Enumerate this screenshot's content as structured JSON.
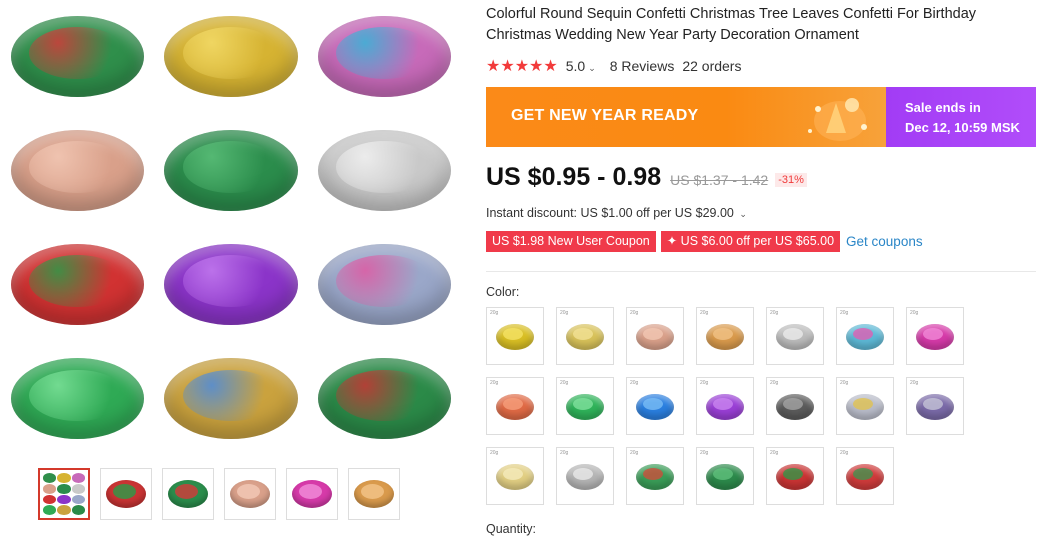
{
  "gallery": {
    "main_tiles": [
      {
        "name": "green-red-tree-leaves",
        "c1": "#2f8f4b",
        "c2": "#d43a3a"
      },
      {
        "name": "gold-round",
        "c1": "#d6b332",
        "c2": "#f4dc6a"
      },
      {
        "name": "multicolor-round",
        "c1": "#c76ab9",
        "c2": "#36b6d8"
      },
      {
        "name": "rose-gold-round",
        "c1": "#d9a08a",
        "c2": "#f3c9b6"
      },
      {
        "name": "green-tree-leaves",
        "c1": "#2b8d4c",
        "c2": "#5cc07a"
      },
      {
        "name": "silver-round",
        "c1": "#c9c9c9",
        "c2": "#f2f2f2"
      },
      {
        "name": "red-green-tree-leaves",
        "c1": "#d13232",
        "c2": "#2a9c48"
      },
      {
        "name": "purple-round",
        "c1": "#8b34c9",
        "c2": "#c47cf0"
      },
      {
        "name": "holographic-mix",
        "c1": "#9aa7c9",
        "c2": "#e05aa3"
      },
      {
        "name": "green-round",
        "c1": "#2faa55",
        "c2": "#7ee39b"
      },
      {
        "name": "multicolor-stars",
        "c1": "#caa23e",
        "c2": "#4b8be0"
      },
      {
        "name": "green-red-leaves-mix",
        "c1": "#2b8a48",
        "c2": "#c93434"
      }
    ],
    "thumbnails": [
      {
        "name": "thumb-all-colors",
        "c1": "#8b34c9",
        "c2": "#d6b332",
        "active": true
      },
      {
        "name": "thumb-red-green",
        "c1": "#c93434",
        "c2": "#2a9c48",
        "active": false
      },
      {
        "name": "thumb-green",
        "c1": "#2b8d4c",
        "c2": "#d43a3a",
        "active": false
      },
      {
        "name": "thumb-rose-gold",
        "c1": "#d9a08a",
        "c2": "#f3c9b6",
        "active": false
      },
      {
        "name": "thumb-pink",
        "c1": "#d63aa9",
        "c2": "#f18ed9",
        "active": false
      },
      {
        "name": "thumb-copper",
        "c1": "#d99a4c",
        "c2": "#f2c489",
        "active": false
      }
    ]
  },
  "product": {
    "title": "Colorful Round Sequin Confetti Christmas Tree Leaves Confetti For Birthday Christmas Wedding New Year Party Decoration Ornament",
    "stars": "★★★★★",
    "rating": "5.0",
    "reviews": "8 Reviews",
    "orders": "22 orders"
  },
  "banner": {
    "headline": "GET NEW YEAR READY",
    "sale_line1": "Sale ends in",
    "sale_line2": "Dec 12, 10:59 MSK",
    "colors": {
      "orange": "#fa8a12",
      "purple": "#a23cf5"
    }
  },
  "pricing": {
    "price": "US $0.95 - 0.98",
    "old_price": "US $1.37 - 1.42",
    "discount": "-31%",
    "instant_discount": "Instant discount: US $1.00 off per US $29.00",
    "coupons": [
      "US $1.98 New User Coupon",
      "✦ US $6.00 off per US $65.00"
    ],
    "get_coupons": "Get coupons"
  },
  "color_section": {
    "label": "Color:",
    "variants": [
      {
        "name": "gold-bright",
        "c1": "#d9bf24",
        "c2": "#f5e46a"
      },
      {
        "name": "gold-light",
        "c1": "#d8c25a",
        "c2": "#f3e39a"
      },
      {
        "name": "rose-gold",
        "c1": "#d9a08a",
        "c2": "#f3c9b6"
      },
      {
        "name": "copper",
        "c1": "#d99a4c",
        "c2": "#f2c489"
      },
      {
        "name": "silver",
        "c1": "#bcbcbc",
        "c2": "#ededed"
      },
      {
        "name": "multicolor",
        "c1": "#5db9d6",
        "c2": "#e85ab0"
      },
      {
        "name": "pink",
        "c1": "#d63aa9",
        "c2": "#f18ed9"
      },
      {
        "name": "orange-red",
        "c1": "#e06a45",
        "c2": "#f7a27f"
      },
      {
        "name": "green",
        "c1": "#2fb35a",
        "c2": "#86e3a2"
      },
      {
        "name": "blue",
        "c1": "#2a7fe0",
        "c2": "#7fc0f5"
      },
      {
        "name": "purple",
        "c1": "#9a3fd6",
        "c2": "#cc8af0"
      },
      {
        "name": "black-silver",
        "c1": "#5b5b5b",
        "c2": "#a8a8a8"
      },
      {
        "name": "holographic",
        "c1": "#b9bcc9",
        "c2": "#e3c34a"
      },
      {
        "name": "laser-purple",
        "c1": "#7a6aa8",
        "c2": "#c9c9d9"
      },
      {
        "name": "champagne",
        "c1": "#e2cf83",
        "c2": "#f6ecbf"
      },
      {
        "name": "silver-stars",
        "c1": "#b5b5b5",
        "c2": "#ececec"
      },
      {
        "name": "green-leaves",
        "c1": "#3a9d58",
        "c2": "#d64a3a"
      },
      {
        "name": "dark-green-leaves",
        "c1": "#2c8a4b",
        "c2": "#63c37f"
      },
      {
        "name": "red-green-leaves",
        "c1": "#c93434",
        "c2": "#2a9c48"
      },
      {
        "name": "green-red-mix",
        "c1": "#cf3b3b",
        "c2": "#3a9850"
      }
    ],
    "variant_tag": "20g"
  },
  "quantity": {
    "label": "Quantity:"
  }
}
